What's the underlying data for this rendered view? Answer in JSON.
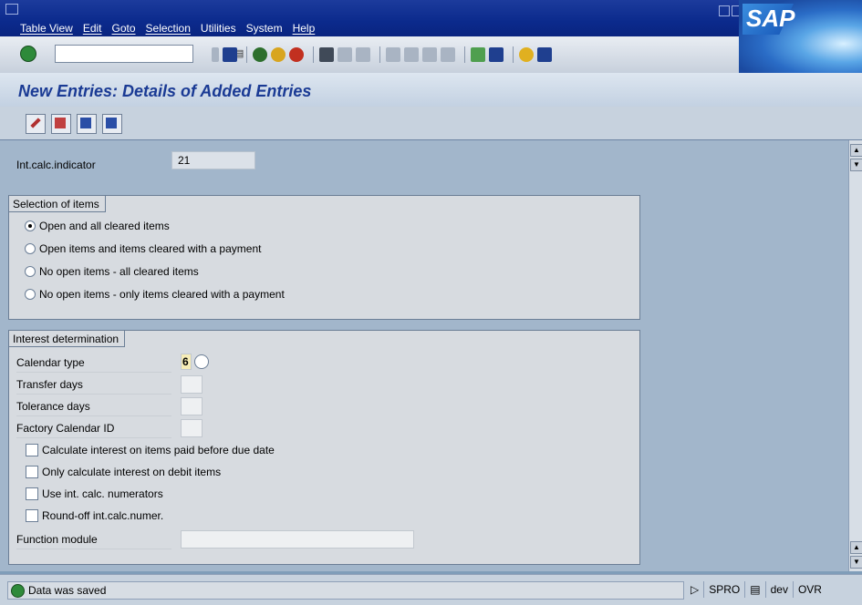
{
  "menu": {
    "items": [
      "Table View",
      "Edit",
      "Goto",
      "Selection",
      "Utilities",
      "System",
      "Help"
    ]
  },
  "brand": {
    "logo_text": "SAP"
  },
  "toolbar": {
    "icons": [
      "enter-icon",
      "back-icon",
      "exit-icon",
      "cancel-icon",
      "save-icon",
      "print-icon",
      "find-icon",
      "find-next-icon",
      "first-page-icon",
      "previous-page-icon",
      "next-page-icon",
      "last-page-icon",
      "create-session-icon",
      "create-shortcut-icon",
      "help-icon",
      "customize-layout-icon"
    ]
  },
  "screen": {
    "title": "New Entries: Details of Added Entries"
  },
  "app_toolbar": {
    "icons": [
      "display-change-icon",
      "delete-entry-icon",
      "previous-entry-icon",
      "next-entry-icon"
    ]
  },
  "fields": {
    "int_calc_indicator_label": "Int.calc.indicator",
    "int_calc_indicator_value": "21"
  },
  "selection_group": {
    "title": "Selection of items",
    "options": [
      "Open and all cleared items",
      "Open items and items cleared with a payment",
      "No open items - all cleared items",
      "No open items - only items cleared with a payment"
    ],
    "selected_index": 0
  },
  "interest_group": {
    "title": "Interest determination",
    "calendar_type_label": "Calendar type",
    "calendar_type_value": "6",
    "transfer_days_label": "Transfer days",
    "tolerance_days_label": "Tolerance days",
    "factory_calendar_label": "Factory Calendar ID",
    "checkboxes": [
      "Calculate interest on items paid before due date",
      "Only calculate interest on debit items",
      "Use int. calc. numerators",
      "Round-off int.calc.numer."
    ],
    "function_module_label": "Function module"
  },
  "statusbar": {
    "message": "Data was saved",
    "transaction": "SPRO",
    "system": "dev",
    "mode": "OVR"
  }
}
